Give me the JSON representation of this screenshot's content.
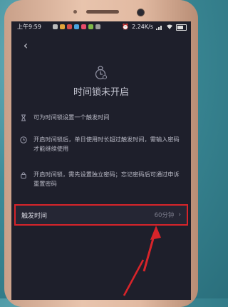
{
  "status_bar": {
    "time": "上午9:59",
    "network_speed": "2.24K/s",
    "notification_icons": [
      "app-icon-1",
      "app-icon-2",
      "app-icon-3",
      "app-icon-4",
      "app-icon-5",
      "app-icon-6",
      "app-icon-7"
    ],
    "system_icons": [
      "alarm-icon",
      "signal-icon",
      "wifi-icon",
      "battery-icon"
    ]
  },
  "header": {
    "back_icon": "chevron-left-icon"
  },
  "hero": {
    "icon": "clock-lock-icon",
    "title": "时间锁未开启"
  },
  "features": [
    {
      "icon": "hourglass-icon",
      "text": "可为时间锁设置一个触发时间"
    },
    {
      "icon": "clock-icon",
      "text": "开启时间锁后，单日使用时长超过触发时间，需输入密码才能继续使用"
    },
    {
      "icon": "lock-icon",
      "text": "开启时间锁，需先设置独立密码；忘记密码后可通过申诉重置密码"
    }
  ],
  "trigger_row": {
    "label": "触发时间",
    "value": "60分钟",
    "highlight_color": "#d8242a"
  },
  "colors": {
    "screen_bg": "#1e1f2b",
    "annotation_red": "#d8242a",
    "phone_frame": "#e2baa2"
  }
}
